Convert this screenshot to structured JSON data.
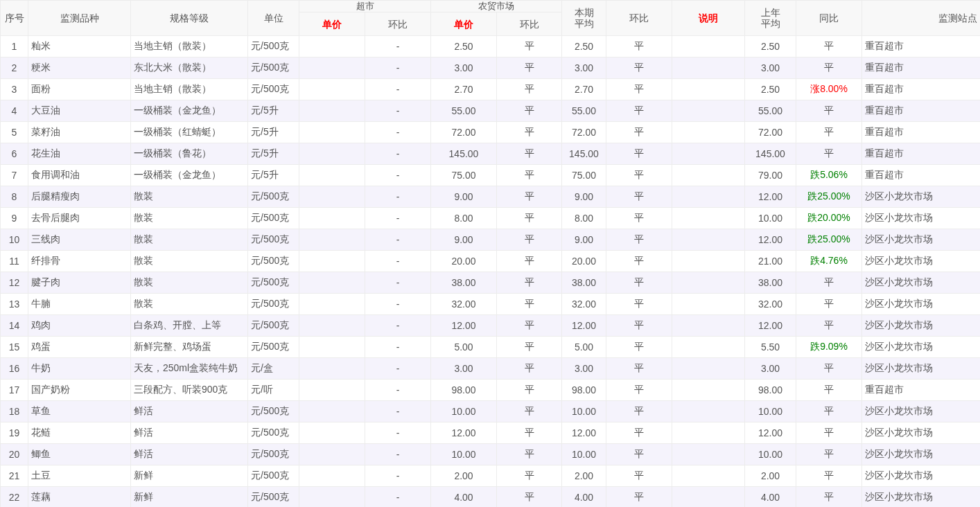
{
  "table": {
    "columns": [
      {
        "label": "序号",
        "emphasis": false
      },
      {
        "label": "监测品种",
        "emphasis": false
      },
      {
        "label": "规格等级",
        "emphasis": false
      },
      {
        "label": "单位",
        "emphasis": false
      },
      {
        "label": "超市",
        "emphasis": false,
        "children": [
          {
            "label": "单价",
            "emphasis": true
          },
          {
            "label": "环比",
            "emphasis": false
          }
        ]
      },
      {
        "label": "农贸市场",
        "emphasis": false,
        "children": [
          {
            "label": "单价",
            "emphasis": true
          },
          {
            "label": "环比",
            "emphasis": false
          }
        ]
      },
      {
        "lines": [
          "本期",
          "平均"
        ],
        "emphasis": false
      },
      {
        "label": "环比",
        "emphasis": false
      },
      {
        "label": "说明",
        "emphasis": true
      },
      {
        "lines": [
          "上年",
          "平均"
        ],
        "emphasis": false
      },
      {
        "label": "同比",
        "emphasis": false
      },
      {
        "label": "监测站点",
        "emphasis": false
      }
    ],
    "rows": [
      {
        "no": "1",
        "item": "籼米",
        "spec": "当地主销（散装）",
        "unit": "元/500克",
        "super_change": "-",
        "market_price": "2.50",
        "market_change": "平",
        "avg": "2.50",
        "change": "平",
        "last_year": "2.50",
        "yoy": "平",
        "color": "#555555",
        "station": "重百超市"
      },
      {
        "no": "2",
        "item": "粳米",
        "spec": "东北大米（散装）",
        "unit": "元/500克",
        "super_change": "-",
        "market_price": "3.00",
        "market_change": "平",
        "avg": "3.00",
        "change": "平",
        "last_year": "3.00",
        "yoy": "平",
        "color": "#555555",
        "station": "重百超市"
      },
      {
        "no": "3",
        "item": "面粉",
        "spec": "当地主销（散装）",
        "unit": "元/500克",
        "super_change": "-",
        "market_price": "2.70",
        "market_change": "平",
        "avg": "2.70",
        "change": "平",
        "last_year": "2.50",
        "yoy": "涨8.00%",
        "color": "#ff0000",
        "station": "重百超市"
      },
      {
        "no": "4",
        "item": "大豆油",
        "spec": "一级桶装（金龙鱼）",
        "unit": "元/5升",
        "super_change": "-",
        "market_price": "55.00",
        "market_change": "平",
        "avg": "55.00",
        "change": "平",
        "last_year": "55.00",
        "yoy": "平",
        "color": "#555555",
        "station": "重百超市"
      },
      {
        "no": "5",
        "item": "菜籽油",
        "spec": "一级桶装（红蜻蜓）",
        "unit": "元/5升",
        "super_change": "-",
        "market_price": "72.00",
        "market_change": "平",
        "avg": "72.00",
        "change": "平",
        "last_year": "72.00",
        "yoy": "平",
        "color": "#555555",
        "station": "重百超市"
      },
      {
        "no": "6",
        "item": "花生油",
        "spec": "一级桶装（鲁花）",
        "unit": "元/5升",
        "super_change": "-",
        "market_price": "145.00",
        "market_change": "平",
        "avg": "145.00",
        "change": "平",
        "last_year": "145.00",
        "yoy": "平",
        "color": "#555555",
        "station": "重百超市"
      },
      {
        "no": "7",
        "item": "食用调和油",
        "spec": "一级桶装（金龙鱼）",
        "unit": "元/5升",
        "super_change": "-",
        "market_price": "75.00",
        "market_change": "平",
        "avg": "75.00",
        "change": "平",
        "last_year": "79.00",
        "yoy": "跌5.06%",
        "color": "#008000",
        "station": "重百超市"
      },
      {
        "no": "8",
        "item": "后腿精瘦肉",
        "spec": "散装",
        "unit": "元/500克",
        "super_change": "-",
        "market_price": "9.00",
        "market_change": "平",
        "avg": "9.00",
        "change": "平",
        "last_year": "12.00",
        "yoy": "跌25.00%",
        "color": "#008000",
        "station": "沙区小龙坎市场"
      },
      {
        "no": "9",
        "item": "去骨后腿肉",
        "spec": "散装",
        "unit": "元/500克",
        "super_change": "-",
        "market_price": "8.00",
        "market_change": "平",
        "avg": "8.00",
        "change": "平",
        "last_year": "10.00",
        "yoy": "跌20.00%",
        "color": "#008000",
        "station": "沙区小龙坎市场"
      },
      {
        "no": "10",
        "item": "三线肉",
        "spec": "散装",
        "unit": "元/500克",
        "super_change": "-",
        "market_price": "9.00",
        "market_change": "平",
        "avg": "9.00",
        "change": "平",
        "last_year": "12.00",
        "yoy": "跌25.00%",
        "color": "#008000",
        "station": "沙区小龙坎市场"
      },
      {
        "no": "11",
        "item": "纤排骨",
        "spec": "散装",
        "unit": "元/500克",
        "super_change": "-",
        "market_price": "20.00",
        "market_change": "平",
        "avg": "20.00",
        "change": "平",
        "last_year": "21.00",
        "yoy": "跌4.76%",
        "color": "#008000",
        "station": "沙区小龙坎市场"
      },
      {
        "no": "12",
        "item": "腱子肉",
        "spec": "散装",
        "unit": "元/500克",
        "super_change": "-",
        "market_price": "38.00",
        "market_change": "平",
        "avg": "38.00",
        "change": "平",
        "last_year": "38.00",
        "yoy": "平",
        "color": "#555555",
        "station": "沙区小龙坎市场"
      },
      {
        "no": "13",
        "item": "牛腩",
        "spec": "散装",
        "unit": "元/500克",
        "super_change": "-",
        "market_price": "32.00",
        "market_change": "平",
        "avg": "32.00",
        "change": "平",
        "last_year": "32.00",
        "yoy": "平",
        "color": "#555555",
        "station": "沙区小龙坎市场"
      },
      {
        "no": "14",
        "item": "鸡肉",
        "spec": "白条鸡、开膛、上等",
        "unit": "元/500克",
        "super_change": "-",
        "market_price": "12.00",
        "market_change": "平",
        "avg": "12.00",
        "change": "平",
        "last_year": "12.00",
        "yoy": "平",
        "color": "#555555",
        "station": "沙区小龙坎市场"
      },
      {
        "no": "15",
        "item": "鸡蛋",
        "spec": "新鲜完整、鸡场蛋",
        "unit": "元/500克",
        "super_change": "-",
        "market_price": "5.00",
        "market_change": "平",
        "avg": "5.00",
        "change": "平",
        "last_year": "5.50",
        "yoy": "跌9.09%",
        "color": "#008000",
        "station": "沙区小龙坎市场"
      },
      {
        "no": "16",
        "item": "牛奶",
        "spec": "天友，250ml盒装纯牛奶",
        "unit": "元/盒",
        "super_change": "-",
        "market_price": "3.00",
        "market_change": "平",
        "avg": "3.00",
        "change": "平",
        "last_year": "3.00",
        "yoy": "平",
        "color": "#555555",
        "station": "沙区小龙坎市场"
      },
      {
        "no": "17",
        "item": "国产奶粉",
        "spec": "三段配方、听装900克",
        "unit": "元/听",
        "super_change": "-",
        "market_price": "98.00",
        "market_change": "平",
        "avg": "98.00",
        "change": "平",
        "last_year": "98.00",
        "yoy": "平",
        "color": "#555555",
        "station": "重百超市"
      },
      {
        "no": "18",
        "item": "草鱼",
        "spec": "鲜活",
        "unit": "元/500克",
        "super_change": "-",
        "market_price": "10.00",
        "market_change": "平",
        "avg": "10.00",
        "change": "平",
        "last_year": "10.00",
        "yoy": "平",
        "color": "#555555",
        "station": "沙区小龙坎市场"
      },
      {
        "no": "19",
        "item": "花鲢",
        "spec": "鲜活",
        "unit": "元/500克",
        "super_change": "-",
        "market_price": "12.00",
        "market_change": "平",
        "avg": "12.00",
        "change": "平",
        "last_year": "12.00",
        "yoy": "平",
        "color": "#555555",
        "station": "沙区小龙坎市场"
      },
      {
        "no": "20",
        "item": "鲫鱼",
        "spec": "鲜活",
        "unit": "元/500克",
        "super_change": "-",
        "market_price": "10.00",
        "market_change": "平",
        "avg": "10.00",
        "change": "平",
        "last_year": "10.00",
        "yoy": "平",
        "color": "#555555",
        "station": "沙区小龙坎市场"
      },
      {
        "no": "21",
        "item": "土豆",
        "spec": "新鲜",
        "unit": "元/500克",
        "super_change": "-",
        "market_price": "2.00",
        "market_change": "平",
        "avg": "2.00",
        "change": "平",
        "last_year": "2.00",
        "yoy": "平",
        "color": "#555555",
        "station": "沙区小龙坎市场"
      },
      {
        "no": "22",
        "item": "莲藕",
        "spec": "新鲜",
        "unit": "元/500克",
        "super_change": "-",
        "market_price": "4.00",
        "market_change": "平",
        "avg": "4.00",
        "change": "平",
        "last_year": "4.00",
        "yoy": "平",
        "color": "#555555",
        "station": "沙区小龙坎市场"
      }
    ]
  }
}
